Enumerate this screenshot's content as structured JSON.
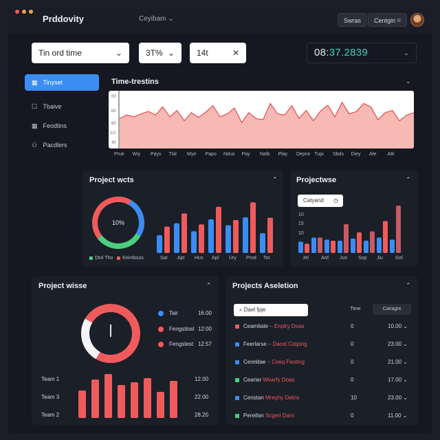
{
  "app": {
    "title": "Prddovity",
    "menu": "Ceyibam ⌄"
  },
  "top_buttons": {
    "b1": "Swras",
    "b2": "Centgin ⌾"
  },
  "filters": {
    "field1": "Tin ord time",
    "field2": "3T%",
    "field3": "14t",
    "timer_main": "08:",
    "timer_accent": "37.2839"
  },
  "sidebar": {
    "items": [
      {
        "label": "Tinyset",
        "icon": "▦"
      },
      {
        "label": "Tbaive",
        "icon": "☐"
      },
      {
        "label": "Feodtins",
        "icon": "▦"
      },
      {
        "label": "Pacdlers",
        "icon": "⚇"
      }
    ]
  },
  "time_panel": {
    "title": "Time-trestins",
    "ylabels": [
      "00",
      "b0",
      "60",
      "1/2",
      "40"
    ],
    "xlabels": [
      "Prue",
      "Wiy",
      "Pays",
      "Tlal",
      "Mye",
      "Papo",
      "Ndus",
      "Pay",
      "Nalb",
      "Play",
      "Depce",
      "Tupi",
      "Sbds",
      "Diey",
      "Afe",
      "Atk"
    ]
  },
  "project_wcts": {
    "title": "Project wcts",
    "donut_label": "10%",
    "legend": [
      "Dtol Tho",
      "Eeintbsos"
    ],
    "xlabels": [
      "Sat",
      "Apt",
      "Hus",
      "Apl",
      "Ury",
      "Prod",
      "Tot"
    ]
  },
  "projective": {
    "title": "Projectwse",
    "pill": "Catyand",
    "ylabels": [
      "10",
      "15",
      "10"
    ],
    "xlabels": [
      "Jel",
      "Ard",
      "Jun",
      "Sop",
      "Jiu",
      "Gel"
    ]
  },
  "project_wisse": {
    "title": "Project wisse",
    "legend": [
      {
        "label": "Tair",
        "value": "16.00"
      },
      {
        "label": "Fengstiost",
        "value": "12:00"
      },
      {
        "label": "Fengstest",
        "value": "12:57"
      }
    ],
    "teams": [
      {
        "label": "Team 1",
        "value": "12.00"
      },
      {
        "label": "Team 3",
        "value": "22.00"
      },
      {
        "label": "Team 2",
        "value": "28.20"
      }
    ]
  },
  "projects_aseletion": {
    "title": "Projects Aseletion",
    "search_placeholder": "Dael fpje",
    "col_time": "Time",
    "col_category": "Cariagnt",
    "rows": [
      {
        "name": "Ceamliate",
        "tag": "– Enplry Doas",
        "time": "0",
        "value": "10.00",
        "color": "#ef5b5b"
      },
      {
        "name": "Feerlarse",
        "tag": "– Dacel Coiping",
        "time": "0",
        "value": "23.00",
        "color": "#3b8df4"
      },
      {
        "name": "Cereldae",
        "tag": "– Cseq Feoting",
        "time": "0",
        "value": "21.00",
        "color": "#3b8df4"
      },
      {
        "name": "Cearier",
        "tag": "Wearfy Doas",
        "time": "0",
        "value": "17.00",
        "color": "#4ccf7d"
      },
      {
        "name": "Censtan",
        "tag": "Mreyhy Detris",
        "time": "10",
        "value": "23.00",
        "color": "#3b8df4"
      },
      {
        "name": "Pereifan",
        "tag": "Scgerl Dars",
        "time": "0",
        "value": "11.00",
        "color": "#4ccf7d"
      }
    ]
  },
  "colors": {
    "accent": "#3b8df4",
    "red": "#ef5b5b",
    "green": "#4ccf7d",
    "teal": "#3fd0c0"
  },
  "chart_data": [
    {
      "type": "area",
      "title": "Time-trestins",
      "categories": [
        "Prue",
        "Wiy",
        "Pays",
        "Tlal",
        "Mye",
        "Papo",
        "Ndus",
        "Pay",
        "Nalb",
        "Play",
        "Depce",
        "Tupi",
        "Sbds",
        "Diey",
        "Afe",
        "Atk"
      ],
      "values": [
        52,
        58,
        55,
        60,
        64,
        58,
        72,
        55,
        66,
        48,
        62,
        54,
        63,
        74,
        55,
        60,
        70,
        45,
        62,
        52,
        50,
        78,
        60,
        58,
        74,
        52,
        66,
        48,
        65,
        75,
        55,
        80,
        60,
        64,
        78,
        72,
        50,
        62,
        66,
        48,
        58,
        62
      ]
    },
    {
      "type": "bar",
      "title": "Project wcts",
      "series": [
        {
          "values": [
            36,
            60,
            44,
            68,
            56,
            72,
            40
          ]
        },
        {
          "values": [
            48,
            72,
            52,
            84,
            60,
            92,
            64
          ]
        }
      ]
    },
    {
      "type": "bar",
      "title": "Projectwse",
      "series": [
        {
          "values": [
            22,
            30,
            26,
            24,
            28,
            24,
            30,
            26
          ]
        },
        {
          "values": [
            18,
            30,
            24,
            56,
            40,
            42,
            62,
            92
          ]
        }
      ]
    },
    {
      "type": "bar",
      "title": "Project wisse",
      "values": [
        40,
        56,
        64,
        48,
        52,
        58,
        38,
        54
      ]
    }
  ]
}
